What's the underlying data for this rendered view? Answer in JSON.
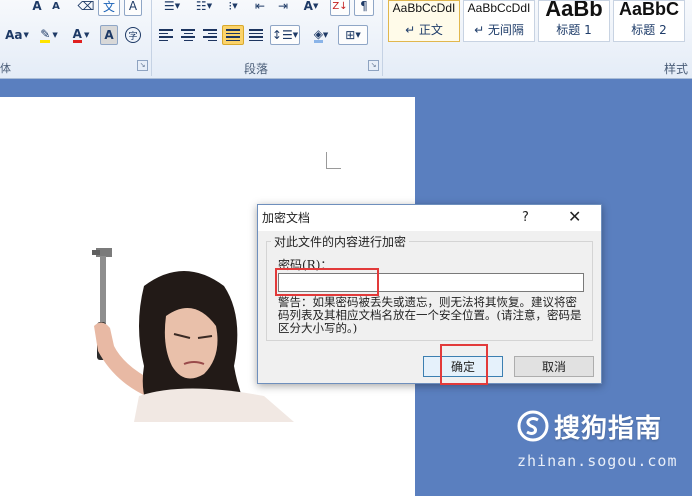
{
  "ribbon": {
    "font_group_label": "体",
    "paragraph_group_label": "段落",
    "styles_group_label": "样式",
    "font_size_button": "Aa",
    "font_color_glyph": "A",
    "char_border_glyph": "A",
    "enclose_glyph": "字",
    "styles": [
      {
        "sample": "AaBbCcDdI",
        "name": "↵ 正文",
        "selected": true
      },
      {
        "sample": "AaBbCcDdI",
        "name": "↵ 无间隔",
        "selected": false
      },
      {
        "sample": "AaBb",
        "name": "标题 1",
        "selected": false
      },
      {
        "sample": "AaBbC",
        "name": "标题 2",
        "selected": false
      }
    ]
  },
  "dialog": {
    "title": "加密文档",
    "help": "?",
    "close": "✕",
    "group_label": "对此文件的内容进行加密",
    "password_label": "密码(R)：",
    "password_value": "",
    "warning": "警告：如果密码被丢失或遗忘，则无法将其恢复。建议将密码列表及其相应文档名放在一个安全位置。(请注意，密码是区分大小写的。)",
    "ok_label": "确定",
    "cancel_label": "取消"
  },
  "watermark": {
    "brand": "搜狗指南",
    "url": "zhinan.sogou.com"
  },
  "colors": {
    "highlight": "#e23a3a",
    "desktop": "#5a7fbf",
    "selected_style": "#fbd36a"
  }
}
